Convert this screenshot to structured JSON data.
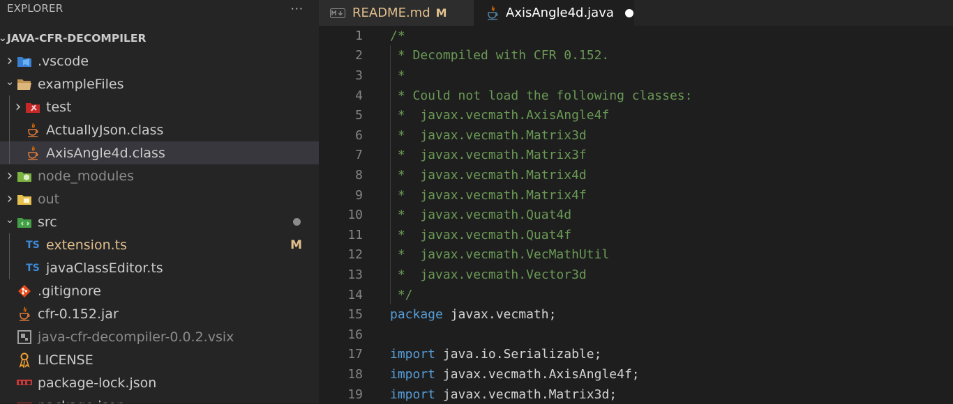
{
  "sidebar": {
    "title": "EXPLORER",
    "more": "···",
    "root": "JAVA-CFR-DECOMPILER",
    "items": [
      {
        "label": ".vscode",
        "type": "folder",
        "icon": "vscode-folder-icon",
        "expanded": false
      },
      {
        "label": "exampleFiles",
        "type": "folder",
        "icon": "folder-open-icon",
        "expanded": true
      },
      {
        "label": "test",
        "type": "folder",
        "icon": "test-folder-icon",
        "expanded": false
      },
      {
        "label": "ActuallyJson.class",
        "type": "file",
        "icon": "java-icon"
      },
      {
        "label": "AxisAngle4d.class",
        "type": "file",
        "icon": "java-icon",
        "selected": true
      },
      {
        "label": "node_modules",
        "type": "folder",
        "icon": "node-folder-icon",
        "expanded": false
      },
      {
        "label": "out",
        "type": "folder",
        "icon": "out-folder-icon",
        "expanded": false
      },
      {
        "label": "src",
        "type": "folder",
        "icon": "src-folder-icon",
        "expanded": true
      },
      {
        "label": "extension.ts",
        "type": "file",
        "icon": "ts-icon",
        "badge": "M"
      },
      {
        "label": "javaClassEditor.ts",
        "type": "file",
        "icon": "ts-icon"
      },
      {
        "label": ".gitignore",
        "type": "file",
        "icon": "git-icon"
      },
      {
        "label": "cfr-0.152.jar",
        "type": "file",
        "icon": "java-icon"
      },
      {
        "label": "java-cfr-decompiler-0.0.2.vsix",
        "type": "file",
        "icon": "vsix-icon"
      },
      {
        "label": "LICENSE",
        "type": "file",
        "icon": "license-icon"
      },
      {
        "label": "package-lock.json",
        "type": "file",
        "icon": "npm-icon"
      },
      {
        "label": "package.json",
        "type": "file",
        "icon": "npm-icon"
      }
    ],
    "ts_label": "TS"
  },
  "tabs": [
    {
      "label": "README.md",
      "badge": "M",
      "icon": "markdown-icon"
    },
    {
      "label": "AxisAngle4d.java",
      "icon": "java-icon",
      "unsaved": true
    }
  ],
  "editor": {
    "lines": [
      {
        "n": "1",
        "parts": [
          {
            "t": "/*",
            "c": "cm"
          }
        ]
      },
      {
        "n": "2",
        "parts": [
          {
            "t": " * Decompiled with CFR 0.152.",
            "c": "cm"
          }
        ]
      },
      {
        "n": "3",
        "parts": [
          {
            "t": " *",
            "c": "cm"
          }
        ]
      },
      {
        "n": "4",
        "parts": [
          {
            "t": " * Could not load the following classes:",
            "c": "cm"
          }
        ]
      },
      {
        "n": "5",
        "parts": [
          {
            "t": " *  javax.vecmath.AxisAngle4f",
            "c": "cm"
          }
        ]
      },
      {
        "n": "6",
        "parts": [
          {
            "t": " *  javax.vecmath.Matrix3d",
            "c": "cm"
          }
        ]
      },
      {
        "n": "7",
        "parts": [
          {
            "t": " *  javax.vecmath.Matrix3f",
            "c": "cm"
          }
        ]
      },
      {
        "n": "8",
        "parts": [
          {
            "t": " *  javax.vecmath.Matrix4d",
            "c": "cm"
          }
        ]
      },
      {
        "n": "9",
        "parts": [
          {
            "t": " *  javax.vecmath.Matrix4f",
            "c": "cm"
          }
        ]
      },
      {
        "n": "10",
        "parts": [
          {
            "t": " *  javax.vecmath.Quat4d",
            "c": "cm"
          }
        ]
      },
      {
        "n": "11",
        "parts": [
          {
            "t": " *  javax.vecmath.Quat4f",
            "c": "cm"
          }
        ]
      },
      {
        "n": "12",
        "parts": [
          {
            "t": " *  javax.vecmath.VecMathUtil",
            "c": "cm"
          }
        ]
      },
      {
        "n": "13",
        "parts": [
          {
            "t": " *  javax.vecmath.Vector3d",
            "c": "cm"
          }
        ]
      },
      {
        "n": "14",
        "parts": [
          {
            "t": " */",
            "c": "cm"
          }
        ]
      },
      {
        "n": "15",
        "parts": [
          {
            "t": "package",
            "c": "kw"
          },
          {
            "t": " javax.vecmath;",
            "c": "plain"
          }
        ]
      },
      {
        "n": "16",
        "parts": []
      },
      {
        "n": "17",
        "parts": [
          {
            "t": "import",
            "c": "kw"
          },
          {
            "t": " java.io.Serializable;",
            "c": "plain"
          }
        ]
      },
      {
        "n": "18",
        "parts": [
          {
            "t": "import",
            "c": "kw"
          },
          {
            "t": " javax.vecmath.AxisAngle4f;",
            "c": "plain"
          }
        ]
      },
      {
        "n": "19",
        "parts": [
          {
            "t": "import",
            "c": "kw"
          },
          {
            "t": " javax.vecmath.Matrix3d;",
            "c": "plain"
          }
        ]
      }
    ]
  },
  "colors": {
    "comment": "#6a9955",
    "keyword": "#569cd6",
    "modified": "#e2c08d",
    "background": "#1e1e1e"
  }
}
